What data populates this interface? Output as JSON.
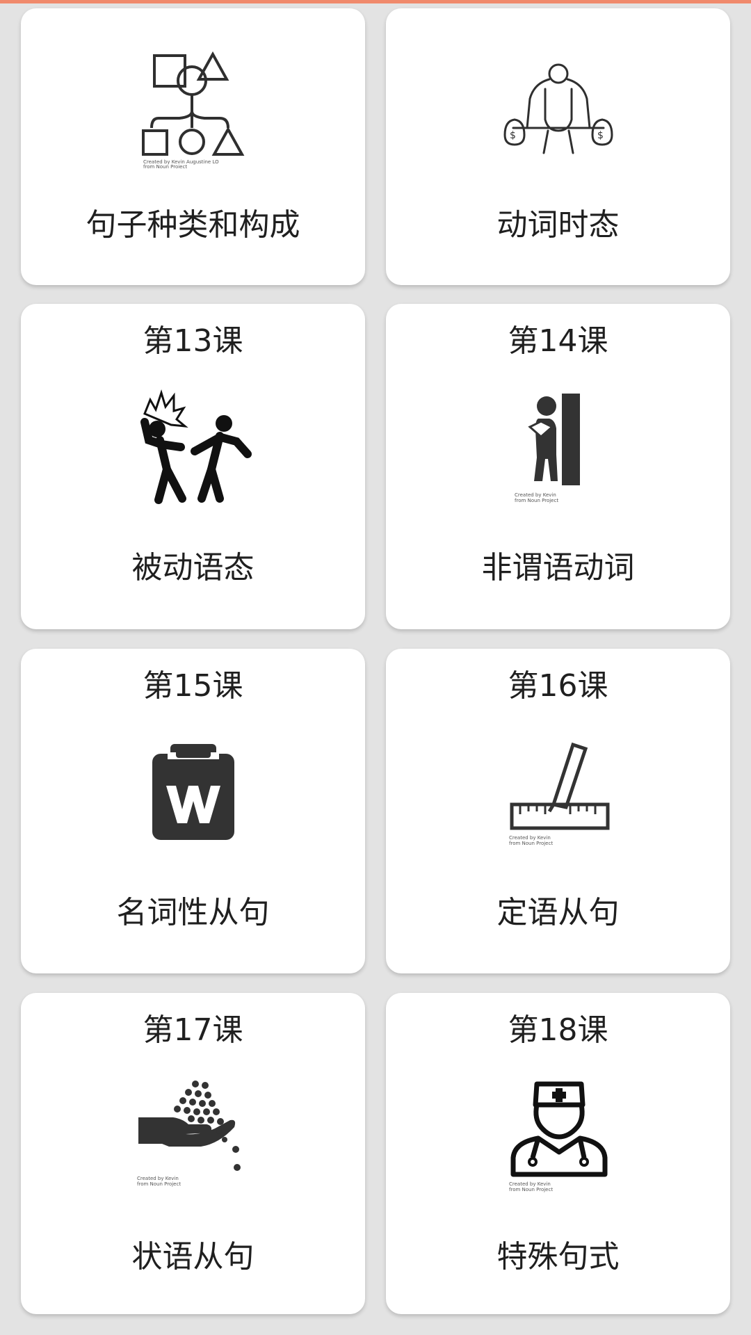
{
  "header": {
    "accent_color": "#f08a6c"
  },
  "cards": [
    {
      "lesson": "",
      "topic": "句子种类和构成",
      "icon": "shapes-diagram-icon"
    },
    {
      "lesson": "",
      "topic": "动词时态",
      "icon": "muscleman-moneybags-icon"
    },
    {
      "lesson": "第13课",
      "topic": "被动语态",
      "icon": "people-fight-icon"
    },
    {
      "lesson": "第14课",
      "topic": "非谓语动词",
      "icon": "reading-person-icon"
    },
    {
      "lesson": "第15课",
      "topic": "名词性从句",
      "icon": "clipboard-w-icon"
    },
    {
      "lesson": "第16课",
      "topic": "定语从句",
      "icon": "ruler-pencil-icon"
    },
    {
      "lesson": "第17课",
      "topic": "状语从句",
      "icon": "hand-seeds-icon"
    },
    {
      "lesson": "第18课",
      "topic": "特殊句式",
      "icon": "doctor-icon"
    }
  ]
}
